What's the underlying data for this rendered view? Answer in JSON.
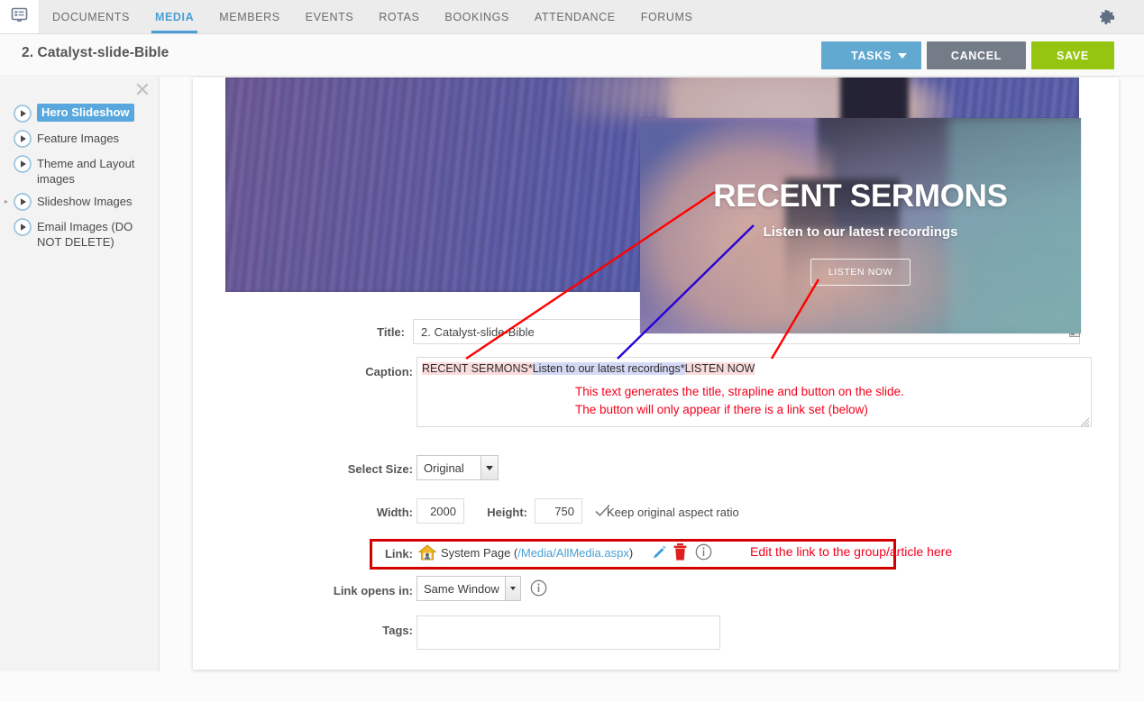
{
  "topnav": {
    "logo_icon": "app-logo-icon",
    "gear_icon": "gear-icon",
    "tabs": [
      {
        "label": "DOCUMENTS",
        "active": false
      },
      {
        "label": "MEDIA",
        "active": true
      },
      {
        "label": "MEMBERS",
        "active": false
      },
      {
        "label": "EVENTS",
        "active": false
      },
      {
        "label": "ROTAS",
        "active": false
      },
      {
        "label": "BOOKINGS",
        "active": false
      },
      {
        "label": "ATTENDANCE",
        "active": false
      },
      {
        "label": "FORUMS",
        "active": false
      }
    ]
  },
  "header": {
    "title": "2. Catalyst-slide-Bible",
    "tasks_label": "TASKS",
    "cancel_label": "CANCEL",
    "save_label": "SAVE",
    "tasks_color": "#62a9d2",
    "cancel_color": "#747c88",
    "save_color": "#96c511"
  },
  "sidebar": {
    "close_icon": "close-icon",
    "items": [
      {
        "label": "Hero Slideshow",
        "selected": true,
        "expandable": false
      },
      {
        "label": "Feature Images",
        "selected": false,
        "expandable": false
      },
      {
        "label": "Theme and Layout images",
        "selected": false,
        "expandable": false
      },
      {
        "label": "Slideshow Images",
        "selected": false,
        "expandable": true
      },
      {
        "label": "Email Images (DO NOT DELETE)",
        "selected": false,
        "expandable": false
      }
    ],
    "selected_color": "#58a7dd"
  },
  "slide_preview": {
    "title": "RECENT SERMONS",
    "subtitle": "Listen to our latest recordings",
    "button_label": "LISTEN NOW"
  },
  "form": {
    "title_label": "Title:",
    "title_value": "2. Catalyst-slide-Bible",
    "caption_label": "Caption:",
    "caption_segments": [
      {
        "text": "RECENT SERMONS*",
        "highlight": "pink"
      },
      {
        "text": "Listen to our latest recordings*",
        "highlight": "blue"
      },
      {
        "text": "LISTEN NOW",
        "highlight": "pink"
      }
    ],
    "caption_value": "RECENT SERMONS*Listen to our latest recordings*LISTEN NOW",
    "caption_note_line1": "This text generates the title, strapline and button on the slide.",
    "caption_note_line2": "The button will only appear if there is a link set (below)",
    "select_size_label": "Select Size:",
    "select_size_value": "Original",
    "select_size_options": [
      "Original"
    ],
    "width_label": "Width:",
    "width_value": "2000",
    "height_label": "Height:",
    "height_value": "750",
    "aspect_label": "Keep original aspect ratio",
    "aspect_checked": true,
    "link_label": "Link:",
    "link_text": "System Page (",
    "link_path": "/Media/AllMedia.aspx",
    "link_text_end": ")",
    "link_icons": [
      "home-icon",
      "pencil-edit-icon",
      "trash-delete-icon",
      "info-icon"
    ],
    "link_note": "Edit the link to the group/article here",
    "opens_label": "Link opens in:",
    "opens_value": "Same Window",
    "opens_options": [
      "Same Window"
    ],
    "tags_label": "Tags:",
    "tags_value": "",
    "annotation_color": "#f3001c",
    "highlight_box_color": "#d40000"
  }
}
